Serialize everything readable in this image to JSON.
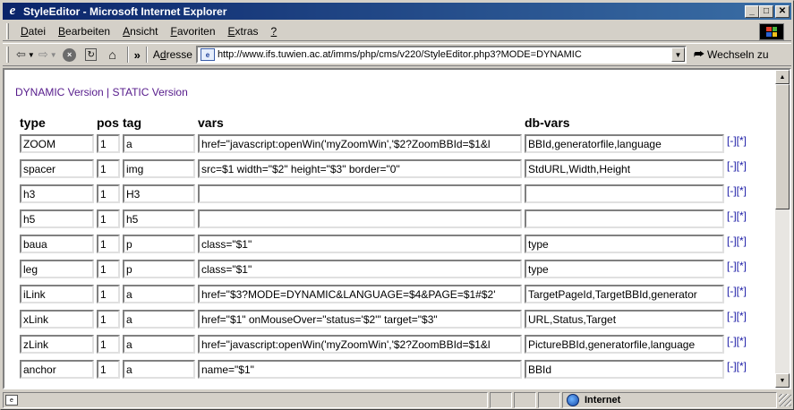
{
  "window": {
    "title": "StyleEditor - Microsoft Internet Explorer",
    "minimize": "_",
    "maximize": "□",
    "close": "✕"
  },
  "menu": {
    "items": [
      {
        "underline": "D",
        "rest": "atei"
      },
      {
        "underline": "B",
        "rest": "earbeiten"
      },
      {
        "underline": "A",
        "rest": "nsicht"
      },
      {
        "underline": "F",
        "rest": "avoriten"
      },
      {
        "underline": "E",
        "rest": "xtras"
      },
      {
        "underline": "?",
        "rest": ""
      }
    ]
  },
  "toolbar": {
    "more": "»",
    "address_label_ul": "d",
    "address_label_pre": "A",
    "address_label_post": "resse",
    "url": "http://www.ifs.tuwien.ac.at/imms/php/cms/v220/StyleEditor.php3?MODE=DYNAMIC",
    "goto_label": "Wechseln zu"
  },
  "page": {
    "dynamic_link": "DYNAMIC Version",
    "separator": "|",
    "static_link": "STATIC Version",
    "headers": {
      "type": "type",
      "pos": "pos",
      "tag": "tag",
      "vars": "vars",
      "dbvars": "db-vars"
    },
    "action_minus": "[-]",
    "action_plus": "[*]",
    "rows": [
      {
        "type": "ZOOM",
        "pos": "1",
        "tag": "a",
        "vars": "href=\"javascript:openWin('myZoomWin','$2?ZoomBBId=$1&l",
        "dbvars": "BBId,generatorfile,language"
      },
      {
        "type": "spacer",
        "pos": "1",
        "tag": "img",
        "vars": "src=$1 width=\"$2\" height=\"$3\" border=\"0\"",
        "dbvars": "StdURL,Width,Height"
      },
      {
        "type": "h3",
        "pos": "1",
        "tag": "H3",
        "vars": "",
        "dbvars": ""
      },
      {
        "type": "h5",
        "pos": "1",
        "tag": "h5",
        "vars": "",
        "dbvars": ""
      },
      {
        "type": "baua",
        "pos": "1",
        "tag": "p",
        "vars": "class=\"$1\"",
        "dbvars": "type"
      },
      {
        "type": "leg",
        "pos": "1",
        "tag": "p",
        "vars": "class=\"$1\"",
        "dbvars": "type"
      },
      {
        "type": "iLink",
        "pos": "1",
        "tag": "a",
        "vars": "href=\"$3?MODE=DYNAMIC&LANGUAGE=$4&PAGE=$1#$2'",
        "dbvars": "TargetPageId,TargetBBId,generator"
      },
      {
        "type": "xLink",
        "pos": "1",
        "tag": "a",
        "vars": "href=\"$1\" onMouseOver=\"status='$2'\" target=\"$3\"",
        "dbvars": "URL,Status,Target"
      },
      {
        "type": "zLink",
        "pos": "1",
        "tag": "a",
        "vars": "href=\"javascript:openWin('myZoomWin','$2?ZoomBBId=$1&l",
        "dbvars": "PictureBBId,generatorfile,language"
      },
      {
        "type": "anchor",
        "pos": "1",
        "tag": "a",
        "vars": "name=\"$1\"",
        "dbvars": "BBId"
      }
    ]
  },
  "status": {
    "zone": "Internet"
  }
}
